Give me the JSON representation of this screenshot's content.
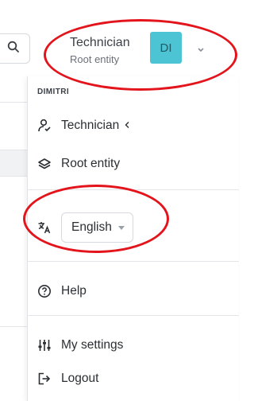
{
  "header": {
    "user_name": "Technician",
    "user_entity": "Root entity",
    "avatar_initials": "DI",
    "avatar_color": "#4cc4d4"
  },
  "menu": {
    "header": "DIMITRI",
    "profile_item": "Technician",
    "entity_item": "Root entity",
    "language_value": "English",
    "help_label": "Help",
    "settings_label": "My settings",
    "logout_label": "Logout"
  },
  "annotation_color": "#e3141b"
}
